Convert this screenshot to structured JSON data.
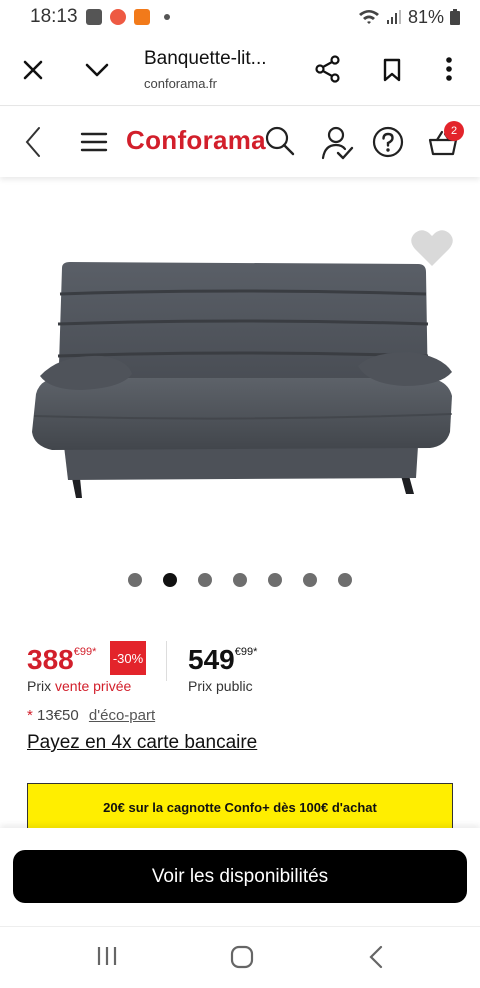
{
  "status_bar": {
    "time": "18:13",
    "battery": "81%"
  },
  "tab_bar": {
    "title": "Banquette-lit...",
    "url": "conforama.fr"
  },
  "site_header": {
    "logo": "Conforama",
    "cart_count": "2"
  },
  "icons": {
    "close": "close-icon",
    "chevron_down": "chevron-down-icon",
    "share": "share-icon",
    "bookmark": "bookmark-icon",
    "more": "more-vertical-icon",
    "back": "chevron-left-icon",
    "menu": "menu-icon",
    "search": "search-icon",
    "account": "account-icon",
    "help": "help-icon",
    "cart": "basket-icon",
    "favorite": "heart-icon"
  },
  "carousel": {
    "total": 7,
    "active_index": 1
  },
  "price": {
    "sale_main": "388",
    "sale_cents": "€99*",
    "discount": "-30%",
    "public_main": "549",
    "public_cents": "€99*",
    "sale_label_prefix": "Prix ",
    "sale_label_highlight": "vente privée",
    "public_label": "Prix public"
  },
  "eco": {
    "star": "*",
    "amount": "13€50",
    "link": "d'éco-part"
  },
  "payment_link": "Payez en 4x carte bancaire",
  "promo_banner": "20€ sur la cagnotte Confo+ dès 100€ d'achat",
  "cta": "Voir les disponibilités",
  "colors": {
    "brand_red": "#d21f2b",
    "promo_yellow": "#ffee00",
    "cta_black": "#000000"
  }
}
